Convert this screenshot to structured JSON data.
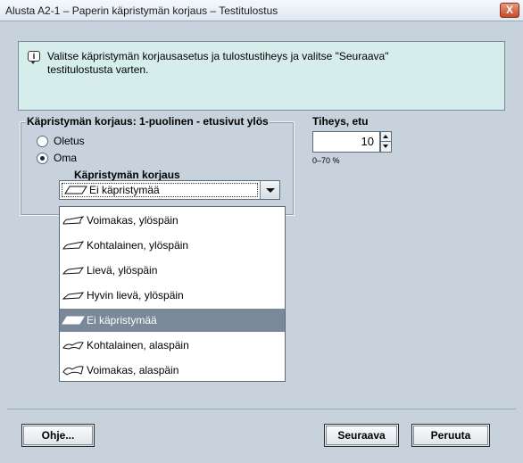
{
  "window": {
    "title": "Alusta A2-1 – Paperin käpristymän korjaus – Testitulostus",
    "close_label": "X"
  },
  "info": {
    "icon": "info-speech-icon",
    "line1": "Valitse käpristymän korjausasetus ja tulostustiheys ja valitse \"Seuraava\"",
    "line2": "testitulostusta varten."
  },
  "curl_group": {
    "legend": "Käpristymän korjaus: 1-puolinen - etusivut ylös",
    "radios": [
      {
        "label": "Oletus",
        "checked": false
      },
      {
        "label": "Oma",
        "checked": true
      }
    ],
    "sub_label": "Käpristymän korjaus",
    "selected_value": "Ei käpristymää"
  },
  "dropdown": {
    "options": [
      {
        "label": "Voimakas, ylöspäin",
        "icon": "curl-up-strong-icon",
        "selected": false
      },
      {
        "label": "Kohtalainen, ylöspäin",
        "icon": "curl-up-medium-icon",
        "selected": false
      },
      {
        "label": "Lievä, ylöspäin",
        "icon": "curl-up-light-icon",
        "selected": false
      },
      {
        "label": "Hyvin lievä, ylöspäin",
        "icon": "curl-up-very-light-icon",
        "selected": false
      },
      {
        "label": "Ei käpristymää",
        "icon": "no-curl-icon",
        "selected": true
      },
      {
        "label": "Kohtalainen, alaspäin",
        "icon": "curl-down-medium-icon",
        "selected": false
      },
      {
        "label": "Voimakas, alaspäin",
        "icon": "curl-down-strong-icon",
        "selected": false
      }
    ]
  },
  "density": {
    "label": "Tiheys, etu",
    "value": "10",
    "range": "0–70 %"
  },
  "buttons": {
    "help": "Ohje...",
    "next": "Seuraava",
    "cancel": "Peruuta"
  },
  "colors": {
    "background": "#c8d2dd",
    "info_panel": "#d6eeeb",
    "selected_option": "#7a8899",
    "close_button": "#c44a2a"
  }
}
